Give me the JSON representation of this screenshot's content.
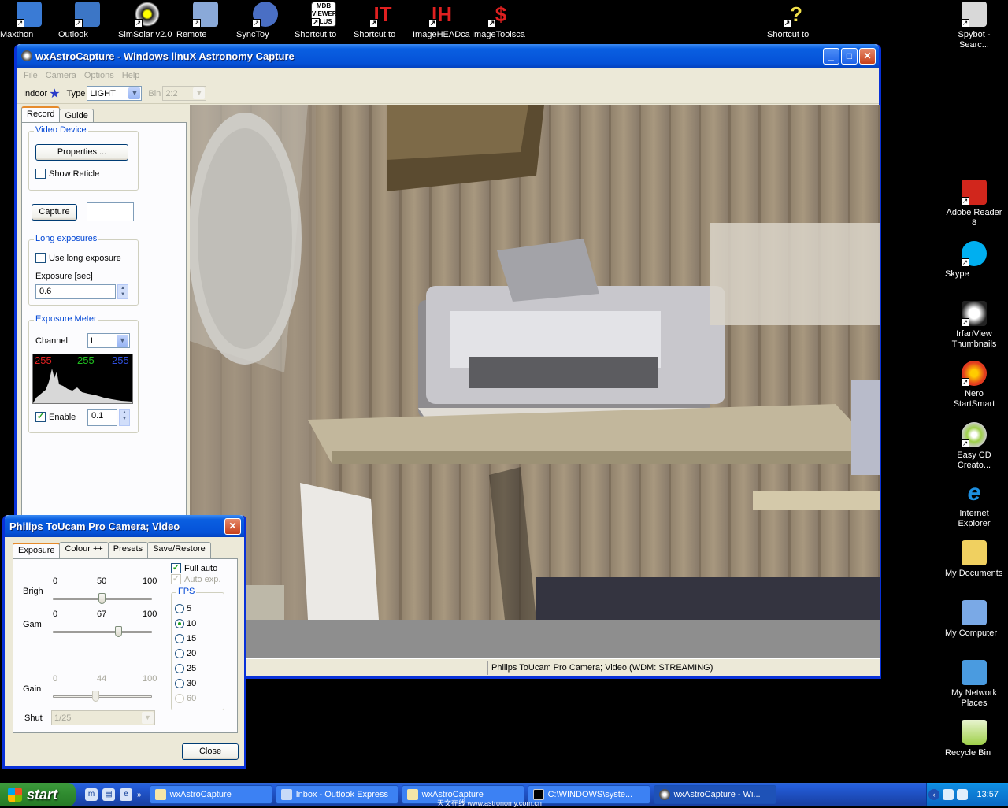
{
  "desktop_icons": [
    {
      "label": "Maxthon",
      "color": "#3a7bd5"
    },
    {
      "label": "Outlook",
      "color": "#3c76c6"
    },
    {
      "label": "SimSolar v2.0",
      "color": "#eeeeee"
    },
    {
      "label": "Remote",
      "color": "#8aa9d8"
    },
    {
      "label": "SyncToy",
      "color": "#4a6fc4"
    },
    {
      "label": "Shortcut to",
      "color": "#ffffff"
    },
    {
      "label": "Shortcut to",
      "color": "#e02020"
    },
    {
      "label": "ImageHEADca",
      "color": "#e02020"
    },
    {
      "label": "ImageToolsca",
      "color": "#e02020"
    },
    {
      "label": "Shortcut to",
      "color": "#f2e04a"
    },
    {
      "label": "Spybot - Searc...",
      "color": "#d8d8d8"
    }
  ],
  "right_icons": [
    {
      "label": "Adobe Reader 8",
      "color": "#d1261c"
    },
    {
      "label": "Skype",
      "color": "#00aff0"
    },
    {
      "label": "IrfanView Thumbnails",
      "color": "#dddddd"
    },
    {
      "label": "Nero StartSmart",
      "color": "#e23b1f"
    },
    {
      "label": "Easy CD Creato...",
      "color": "#9fd04a"
    },
    {
      "label": "Internet Explorer",
      "color": "#1d8fe0"
    },
    {
      "label": "My Documents",
      "color": "#f0d060"
    },
    {
      "label": "My Computer",
      "color": "#7aa9e6"
    },
    {
      "label": "My Network Places",
      "color": "#4a9be0"
    },
    {
      "label": "Recycle Bin",
      "color": "#9fd04a"
    }
  ],
  "main_window": {
    "title": "wxAstroCapture - Windows linuX Astronomy Capture",
    "menu": [
      "File",
      "Camera",
      "Options",
      "Help"
    ],
    "toolbar": {
      "mode_label": "Indoor",
      "type_label": "Type",
      "type_value": "LIGHT",
      "bin_label": "Bin",
      "bin_value": "2:2"
    },
    "tabs": [
      "Record",
      "Guide"
    ],
    "video_device": {
      "title": "Video Device",
      "properties_button": "Properties ...",
      "show_reticle": "Show Reticle"
    },
    "capture_button": "Capture",
    "capture_value": "",
    "long_exposures": {
      "title": "Long exposures",
      "use_long_exposure": "Use long exposure",
      "exposure_label": "Exposure [sec]",
      "exposure_value": "0.6"
    },
    "exposure_meter": {
      "title": "Exposure Meter",
      "channel_label": "Channel",
      "channel_value": "L",
      "r": "255",
      "g": "255",
      "b": "255",
      "enable_label": "Enable",
      "enable_checked": true,
      "enable_value": "0.1"
    },
    "status_text": "Philips ToUcam Pro Camera; Video  (WDM: STREAMING)"
  },
  "camera_dialog": {
    "title": "Philips ToUcam Pro Camera; Video",
    "tabs": [
      "Exposure",
      "Colour ++",
      "Presets",
      "Save/Restore"
    ],
    "sliders": [
      {
        "label": "Brigh",
        "min": "0",
        "value": "50",
        "max": "100",
        "level": 0.5,
        "enabled": true
      },
      {
        "label": "Gam",
        "min": "0",
        "value": "67",
        "max": "100",
        "level": 0.67,
        "enabled": true
      },
      {
        "label": "Gain",
        "min": "0",
        "value": "44",
        "max": "100",
        "level": 0.44,
        "enabled": false
      }
    ],
    "shutter_label": "Shut",
    "shutter_value": "1/25",
    "full_auto": "Full auto",
    "auto_exp": "Auto exp.",
    "fps_title": "FPS",
    "fps_options": [
      "5",
      "10",
      "15",
      "20",
      "25",
      "30",
      "60"
    ],
    "fps_selected": "10",
    "close_button": "Close"
  },
  "taskbar": {
    "start": "start",
    "tasks": [
      "wxAstroCapture",
      "Inbox - Outlook Express",
      "wxAstroCapture",
      "C:\\WINDOWS\\syste...",
      "wxAstroCapture - Wi..."
    ],
    "clock": "13:57",
    "watermark": "天文在线 www.astronomy.com.cn"
  }
}
